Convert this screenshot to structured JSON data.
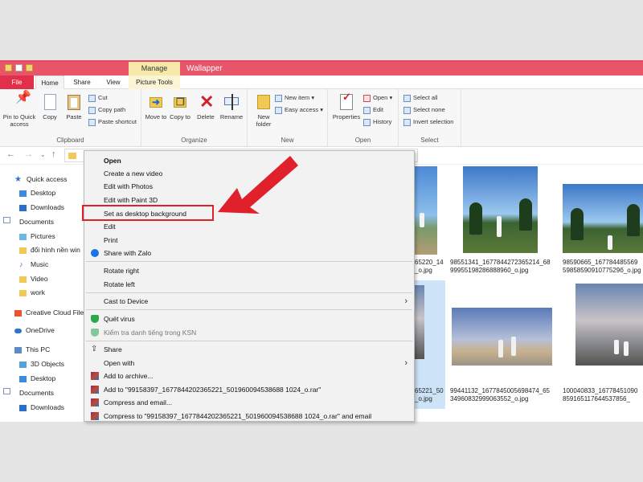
{
  "window": {
    "title": "Wallapper",
    "contextual_tab_group": "Manage"
  },
  "tabs": [
    "File",
    "Home",
    "Share",
    "View",
    "Picture Tools"
  ],
  "ribbon": {
    "clipboard": {
      "pin": "Pin to Quick access",
      "copy": "Copy",
      "paste": "Paste",
      "cut": "Cut",
      "copy_path": "Copy path",
      "paste_shortcut": "Paste shortcut",
      "label": "Clipboard"
    },
    "organize": {
      "move_to": "Move to",
      "copy_to": "Copy to",
      "delete": "Delete",
      "rename": "Rename",
      "label": "Organize"
    },
    "new": {
      "new_folder": "New folder",
      "new_item": "New item",
      "easy_access": "Easy access",
      "label": "New"
    },
    "open": {
      "properties": "Properties",
      "open": "Open",
      "edit": "Edit",
      "history": "History",
      "label": "Open"
    },
    "select": {
      "select_all": "Select all",
      "select_none": "Select none",
      "invert_selection": "Invert selection",
      "label": "Select"
    }
  },
  "sidebar": {
    "items": [
      {
        "label": "Quick access",
        "icon": "star-icon"
      },
      {
        "label": "Desktop",
        "icon": "desktop-icon"
      },
      {
        "label": "Downloads",
        "icon": "download-icon"
      },
      {
        "label": "Documents",
        "icon": "documents-icon"
      },
      {
        "label": "Pictures",
        "icon": "pictures-icon"
      },
      {
        "label": "đổi hình nền win",
        "icon": "folder-icon"
      },
      {
        "label": "Music",
        "icon": "music-icon"
      },
      {
        "label": "Video",
        "icon": "folder-icon"
      },
      {
        "label": "work",
        "icon": "folder-icon"
      },
      {
        "label": "Creative Cloud Files",
        "icon": "creative-cloud-icon"
      },
      {
        "label": "OneDrive",
        "icon": "onedrive-icon"
      },
      {
        "label": "This PC",
        "icon": "pc-icon"
      },
      {
        "label": "3D Objects",
        "icon": "objects-icon"
      },
      {
        "label": "Desktop",
        "icon": "desktop-icon"
      },
      {
        "label": "Documents",
        "icon": "documents-icon"
      },
      {
        "label": "Downloads",
        "icon": "download-icon"
      }
    ]
  },
  "files": [
    {
      "line1": "65220_14",
      "line2": "_o.jpg"
    },
    {
      "line1": "98551341_1677844272365214_68",
      "line2": "99955198286888960_o.jpg"
    },
    {
      "line1": "98590665_167784485569",
      "line2": "5985859091077529б_o.jpg"
    },
    {
      "line1": "65221_50",
      "line2": "_o.jpg"
    },
    {
      "line1": "99441132_1677845005698474_65",
      "line2": "34960832999063552_o.jpg"
    },
    {
      "line1": "100040833_16778451090",
      "line2": "859165117644537856_"
    }
  ],
  "context_menu": {
    "items": [
      {
        "label": "Open",
        "bold": true
      },
      {
        "label": "Create a new video"
      },
      {
        "label": "Edit with Photos"
      },
      {
        "label": "Edit with Paint 3D"
      },
      {
        "label": "Set as desktop background",
        "highlighted": true
      },
      {
        "label": "Edit"
      },
      {
        "label": "Print"
      },
      {
        "label": "Share with Zalo",
        "icon": "zalo-icon"
      },
      {
        "label": "Rotate right"
      },
      {
        "label": "Rotate left"
      },
      {
        "label": "Cast to Device",
        "submenu": true
      },
      {
        "label": "Quét virus",
        "icon": "shield-icon"
      },
      {
        "label": "Kiểm tra danh tiếng trong KSN",
        "icon": "shield-icon",
        "disabled": true
      },
      {
        "label": "Share",
        "icon": "share-icon"
      },
      {
        "label": "Open with",
        "submenu": true
      },
      {
        "label": "Add to archive...",
        "icon": "winrar-icon"
      },
      {
        "label": "Add to \"99158397_1677844202365221_501960094538688 1024_o.rar\"",
        "icon": "winrar-icon"
      },
      {
        "label": "Compress and email...",
        "icon": "winrar-icon"
      },
      {
        "label": "Compress to \"99158397_1677844202365221_501960094538688 1024_o.rar\" and email",
        "icon": "winrar-icon"
      }
    ]
  },
  "colors": {
    "title_bar": "#e85468",
    "file_tab": "#e2304a",
    "manage_tab": "#f6e9a9",
    "highlight_box": "#e0202a",
    "arrow": "#e0202a"
  }
}
